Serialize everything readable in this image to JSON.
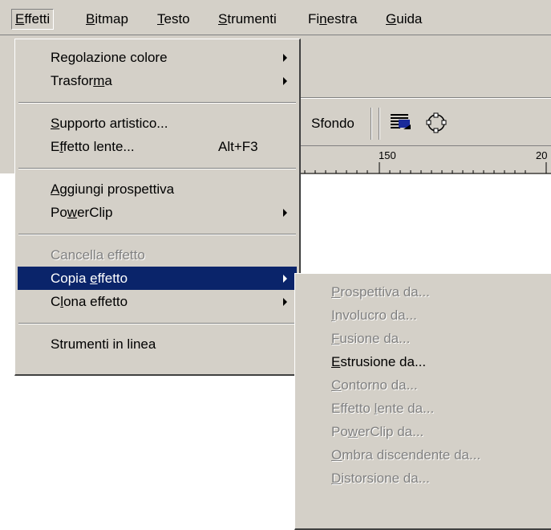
{
  "menubar": {
    "items": [
      {
        "pre": "",
        "key": "E",
        "post": "ffetti"
      },
      {
        "pre": "",
        "key": "B",
        "post": "itmap"
      },
      {
        "pre": "",
        "key": "T",
        "post": "esto"
      },
      {
        "pre": "",
        "key": "S",
        "post": "trumenti"
      },
      {
        "pre": "Fi",
        "key": "n",
        "post": "estra"
      },
      {
        "pre": "",
        "key": "G",
        "post": "uida"
      }
    ]
  },
  "background": {
    "toolbar_label": "Sfondo",
    "ruler_150": "150",
    "ruler_20": "20"
  },
  "effetti_menu": {
    "items": [
      {
        "pre": "Regolazione colore",
        "key": "",
        "post": "",
        "submenu": true
      },
      {
        "pre": "Trasfor",
        "key": "m",
        "post": "a",
        "submenu": true
      },
      {
        "pre": "",
        "key": "S",
        "post": "upporto artistico..."
      },
      {
        "pre": "E",
        "key": "f",
        "post": "fetto lente...",
        "shortcut": "Alt+F3"
      },
      {
        "pre": "",
        "key": "A",
        "post": "ggiungi prospettiva"
      },
      {
        "pre": "Po",
        "key": "w",
        "post": "erClip",
        "submenu": true
      },
      {
        "pre": "Cancella effetto",
        "key": "",
        "post": "",
        "disabled": true
      },
      {
        "pre": "Copia ",
        "key": "e",
        "post": "ffetto",
        "submenu": true,
        "selected": true
      },
      {
        "pre": "C",
        "key": "l",
        "post": "ona effetto",
        "submenu": true
      },
      {
        "pre": "Strumenti in linea",
        "key": "",
        "post": ""
      }
    ]
  },
  "copia_submenu": {
    "items": [
      {
        "pre": "",
        "key": "P",
        "post": "rospettiva da...",
        "disabled": true
      },
      {
        "pre": "",
        "key": "I",
        "post": "nvolucro da...",
        "disabled": true
      },
      {
        "pre": "",
        "key": "F",
        "post": "usione da...",
        "disabled": true
      },
      {
        "pre": "",
        "key": "E",
        "post": "strusione da..."
      },
      {
        "pre": "",
        "key": "C",
        "post": "ontorno da...",
        "disabled": true
      },
      {
        "pre": "Effetto ",
        "key": "l",
        "post": "ente da...",
        "disabled": true
      },
      {
        "pre": "Po",
        "key": "w",
        "post": "erClip da...",
        "disabled": true
      },
      {
        "pre": "",
        "key": "O",
        "post": "mbra discendente da...",
        "disabled": true
      },
      {
        "pre": "",
        "key": "D",
        "post": "istorsione da...",
        "disabled": true
      }
    ]
  }
}
